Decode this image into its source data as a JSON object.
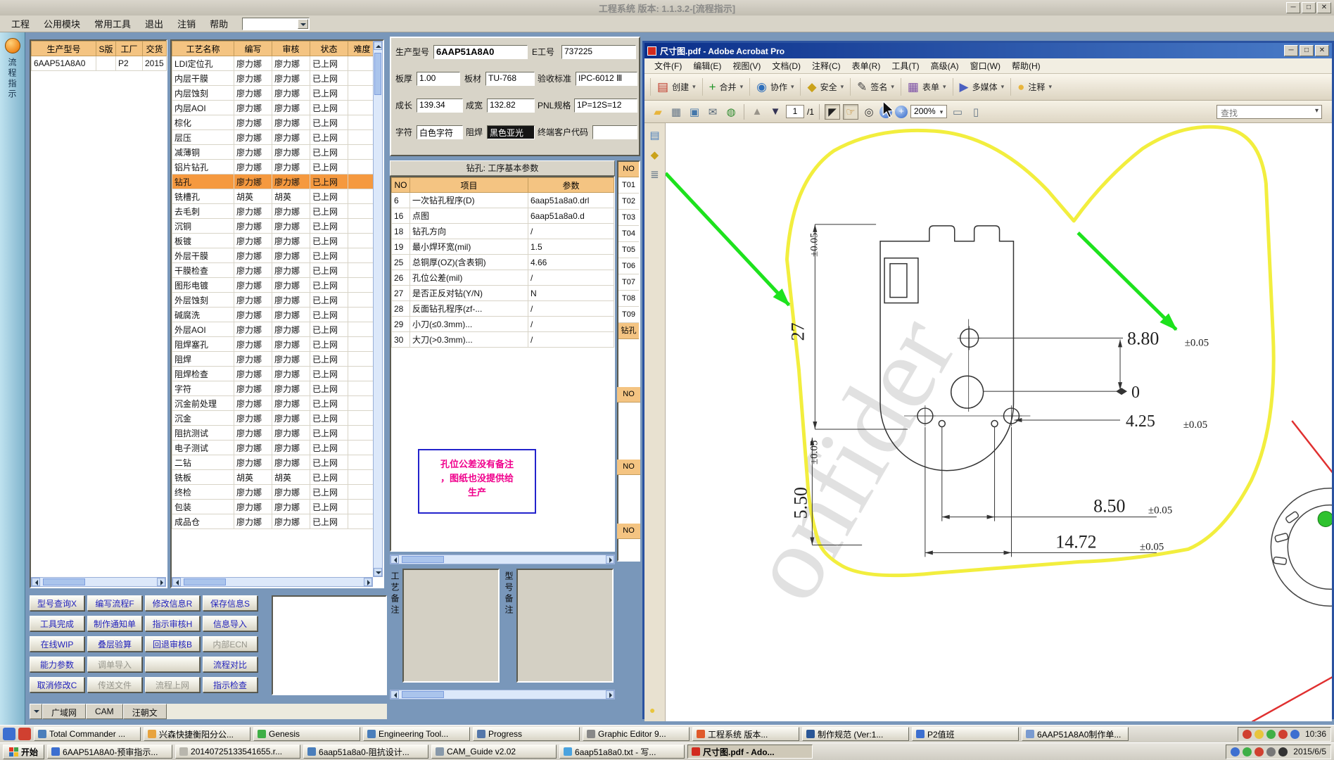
{
  "win_glyphs": {
    "min": "─",
    "max": "□",
    "close": "✕"
  },
  "eng": {
    "title": "工程系统 版本: 1.1.3.2-[流程指示]",
    "menu": [
      "工程",
      "公用模块",
      "常用工具",
      "退出",
      "注销",
      "帮助"
    ],
    "strip_label": "流程指示",
    "product": {
      "headers": [
        "生产型号",
        "S版",
        "工厂",
        "交货"
      ],
      "rows": [
        {
          "model": "6AAP51A8A0",
          "sver": "",
          "factory": "P2",
          "delivery": "2015"
        }
      ]
    },
    "process": {
      "headers": [
        "工艺名称",
        "编写",
        "审核",
        "状态",
        "难度"
      ],
      "rows": [
        {
          "name": "LDI定位孔",
          "writer": "廖力娜",
          "auditor": "廖力娜",
          "status": "已上网",
          "diff": ""
        },
        {
          "name": "内层干膜",
          "writer": "廖力娜",
          "auditor": "廖力娜",
          "status": "已上网",
          "diff": ""
        },
        {
          "name": "内层蚀刻",
          "writer": "廖力娜",
          "auditor": "廖力娜",
          "status": "已上网",
          "diff": ""
        },
        {
          "name": "内层AOI",
          "writer": "廖力娜",
          "auditor": "廖力娜",
          "status": "已上网",
          "diff": ""
        },
        {
          "name": "棕化",
          "writer": "廖力娜",
          "auditor": "廖力娜",
          "status": "已上网",
          "diff": ""
        },
        {
          "name": "层压",
          "writer": "廖力娜",
          "auditor": "廖力娜",
          "status": "已上网",
          "diff": ""
        },
        {
          "name": "减薄铜",
          "writer": "廖力娜",
          "auditor": "廖力娜",
          "status": "已上网",
          "diff": ""
        },
        {
          "name": "铝片钻孔",
          "writer": "廖力娜",
          "auditor": "廖力娜",
          "status": "已上网",
          "diff": ""
        },
        {
          "name": "钻孔",
          "writer": "廖力娜",
          "auditor": "廖力娜",
          "status": "已上网",
          "diff": "",
          "hl": true
        },
        {
          "name": "铣槽孔",
          "writer": "胡英",
          "auditor": "胡英",
          "status": "已上网",
          "diff": ""
        },
        {
          "name": "去毛刺",
          "writer": "廖力娜",
          "auditor": "廖力娜",
          "status": "已上网",
          "diff": ""
        },
        {
          "name": "沉铜",
          "writer": "廖力娜",
          "auditor": "廖力娜",
          "status": "已上网",
          "diff": ""
        },
        {
          "name": "板镀",
          "writer": "廖力娜",
          "auditor": "廖力娜",
          "status": "已上网",
          "diff": ""
        },
        {
          "name": "外层干膜",
          "writer": "廖力娜",
          "auditor": "廖力娜",
          "status": "已上网",
          "diff": ""
        },
        {
          "name": "干膜检查",
          "writer": "廖力娜",
          "auditor": "廖力娜",
          "status": "已上网",
          "diff": ""
        },
        {
          "name": "图形电镀",
          "writer": "廖力娜",
          "auditor": "廖力娜",
          "status": "已上网",
          "diff": ""
        },
        {
          "name": "外层蚀刻",
          "writer": "廖力娜",
          "auditor": "廖力娜",
          "status": "已上网",
          "diff": ""
        },
        {
          "name": "碱腐洗",
          "writer": "廖力娜",
          "auditor": "廖力娜",
          "status": "已上网",
          "diff": ""
        },
        {
          "name": "外层AOI",
          "writer": "廖力娜",
          "auditor": "廖力娜",
          "status": "已上网",
          "diff": ""
        },
        {
          "name": "阻焊塞孔",
          "writer": "廖力娜",
          "auditor": "廖力娜",
          "status": "已上网",
          "diff": ""
        },
        {
          "name": "阻焊",
          "writer": "廖力娜",
          "auditor": "廖力娜",
          "status": "已上网",
          "diff": ""
        },
        {
          "name": "阻焊检查",
          "writer": "廖力娜",
          "auditor": "廖力娜",
          "status": "已上网",
          "diff": ""
        },
        {
          "name": "字符",
          "writer": "廖力娜",
          "auditor": "廖力娜",
          "status": "已上网",
          "diff": ""
        },
        {
          "name": "沉金前处理",
          "writer": "廖力娜",
          "auditor": "廖力娜",
          "status": "已上网",
          "diff": ""
        },
        {
          "name": "沉金",
          "writer": "廖力娜",
          "auditor": "廖力娜",
          "status": "已上网",
          "diff": ""
        },
        {
          "name": "阻抗测试",
          "writer": "廖力娜",
          "auditor": "廖力娜",
          "status": "已上网",
          "diff": ""
        },
        {
          "name": "电子测试",
          "writer": "廖力娜",
          "auditor": "廖力娜",
          "status": "已上网",
          "diff": ""
        },
        {
          "name": "二钻",
          "writer": "廖力娜",
          "auditor": "廖力娜",
          "status": "已上网",
          "diff": ""
        },
        {
          "name": "铣板",
          "writer": "胡英",
          "auditor": "胡英",
          "status": "已上网",
          "diff": ""
        },
        {
          "name": "终检",
          "writer": "廖力娜",
          "auditor": "廖力娜",
          "status": "已上网",
          "diff": ""
        },
        {
          "name": "包装",
          "writer": "廖力娜",
          "auditor": "廖力娜",
          "status": "已上网",
          "diff": ""
        },
        {
          "name": "成品仓",
          "writer": "廖力娜",
          "auditor": "廖力娜",
          "status": "已上网",
          "diff": ""
        }
      ]
    },
    "info": {
      "model_label": "生产型号",
      "model": "6AAP51A8A0",
      "eid_label": "E工号",
      "eid": "737225",
      "thick_label": "板厚",
      "thick": "1.00",
      "mat_label": "板材",
      "mat": "TU-768",
      "std_label": "验收标准",
      "std": "IPC-6012 Ⅲ",
      "len_label": "成长",
      "len": "139.34",
      "wid_label": "成宽",
      "wid": "132.82",
      "pnl_label": "PNL规格",
      "pnl": "1P=12S=12",
      "char_label": "字符",
      "char": "白色字符",
      "mask_label": "阻焊",
      "mask": "黑色亚光",
      "cli_label": "终端客户代码",
      "cli": ""
    },
    "params": {
      "title": "钻孔: 工序基本参数",
      "headers": [
        "NO",
        "项目",
        "参数"
      ],
      "rows": [
        {
          "no": "6",
          "item": "一次钻孔程序(D)",
          "val": "6aap51a8a0.drl"
        },
        {
          "no": "16",
          "item": "点图",
          "val": "6aap51a8a0.d"
        },
        {
          "no": "18",
          "item": "钻孔方向",
          "val": "/"
        },
        {
          "no": "19",
          "item": "最小焊环宽(mil)",
          "val": "1.5"
        },
        {
          "no": "25",
          "item": "总铜厚(OZ)(含表铜)",
          "val": "4.66"
        },
        {
          "no": "26",
          "item": "孔位公差(mil)",
          "val": "/"
        },
        {
          "no": "27",
          "item": "是否正反对钻(Y/N)",
          "val": "N"
        },
        {
          "no": "28",
          "item": "反面钻孔程序(zf-...",
          "val": "/"
        },
        {
          "no": "29",
          "item": "小刀(≤0.3mm)...",
          "val": "/"
        },
        {
          "no": "30",
          "item": "大刀(>0.3mm)...",
          "val": "/"
        }
      ]
    },
    "toolcol": {
      "header": "NO",
      "items": [
        {
          "t": "T01"
        },
        {
          "t": "T02"
        },
        {
          "t": "T03"
        },
        {
          "t": "T04"
        },
        {
          "t": "T05"
        },
        {
          "t": "T06"
        },
        {
          "t": "T07"
        },
        {
          "t": "T08"
        },
        {
          "t": "T09"
        },
        {
          "t": "钻孔",
          "head": true
        }
      ],
      "sub": [
        "NO",
        "NO",
        "NO"
      ]
    },
    "warning": [
      "孔位公差没有备注",
      "，图纸也没提供给",
      "生产"
    ],
    "remarks": {
      "left": "工艺备注",
      "right": "型号备注"
    },
    "buttons": [
      {
        "label": "型号查询X"
      },
      {
        "label": "编写流程F"
      },
      {
        "label": "修改信息R"
      },
      {
        "label": "保存信息S"
      },
      {
        "label": "工具完成"
      },
      {
        "label": "制作通知单"
      },
      {
        "label": "指示审核H"
      },
      {
        "label": "信息导入"
      },
      {
        "label": "在线WIP"
      },
      {
        "label": "叠层验算"
      },
      {
        "label": "回退审核B"
      },
      {
        "label": "内部ECN",
        "enabled": false
      },
      {
        "label": "能力参数"
      },
      {
        "label": "调单导入",
        "enabled": false
      },
      {
        "label": "",
        "enabled": false
      },
      {
        "label": "流程对比"
      },
      {
        "label": "取消修改C"
      },
      {
        "label": "传送文件",
        "enabled": false
      },
      {
        "label": "流程上网",
        "enabled": false
      },
      {
        "label": "指示检查"
      }
    ],
    "tabs": [
      "广域网",
      "CAM",
      "汪朝文"
    ]
  },
  "acrobat": {
    "title": "尺寸图.pdf - Adobe Acrobat Pro",
    "menu": [
      "文件(F)",
      "编辑(E)",
      "视图(V)",
      "文档(D)",
      "注释(C)",
      "表单(R)",
      "工具(T)",
      "高级(A)",
      "窗口(W)",
      "帮助(H)"
    ],
    "toolbar1": [
      {
        "label": "创建",
        "glyph": "▤",
        "color": "#c03a2b"
      },
      {
        "label": "合并",
        "glyph": "+",
        "color": "#1f9427"
      },
      {
        "label": "协作",
        "glyph": "◉",
        "color": "#2e6fbb"
      },
      {
        "label": "安全",
        "glyph": "◆",
        "color": "#caa21a"
      },
      {
        "label": "签名",
        "glyph": "✎",
        "color": "#444444"
      },
      {
        "label": "表单",
        "glyph": "▦",
        "color": "#7b4fa6"
      },
      {
        "label": "多媒体",
        "glyph": "▶",
        "color": "#4a5fc0"
      },
      {
        "label": "注释",
        "glyph": "●",
        "color": "#e8b53d"
      }
    ],
    "nav": {
      "page": "1",
      "total": "/1",
      "zoom": "200%",
      "find": "查找"
    },
    "drawing": {
      "watermark": "onfider",
      "dim_27": "27",
      "tol_27": "±0.05",
      "dim_550": "5.50",
      "tol_550": "±0.05",
      "dim_880": "8.80",
      "tol_880": "±0.05",
      "dim_0": "0",
      "dim_425": "4.25",
      "tol_425": "±0.05",
      "dim_850": "8.50",
      "tol_850": "±0.05",
      "dim_1472": "14.72",
      "tol_1472": "±0.05"
    }
  },
  "taskbar": {
    "start": "开始",
    "clock": "10:36",
    "date": "2015/6/5",
    "row1": [
      {
        "label": "Total Commander ...",
        "color": "#4a7ebb"
      },
      {
        "label": "兴森快捷衡阳分公...",
        "color": "#e8a33d"
      },
      {
        "label": "Genesis",
        "color": "#3faf46"
      },
      {
        "label": "Engineering Tool...",
        "color": "#4a7ebb"
      },
      {
        "label": "Progress",
        "color": "#5577aa"
      },
      {
        "label": "Graphic Editor 9...",
        "color": "#888888"
      },
      {
        "label": "工程系统  版本...",
        "color": "#e05a2b"
      },
      {
        "label": "制作规范 (Ver:1...",
        "color": "#2b5797"
      },
      {
        "label": "P2值班",
        "color": "#3d6fd0"
      },
      {
        "label": "6AAP51A8A0制作单...",
        "color": "#7a9bd0"
      }
    ],
    "row2": [
      {
        "label": "6AAP51A8A0-预审指示...",
        "color": "#3d6fd0"
      },
      {
        "label": "20140725133541655.r...",
        "color": "#b8b6ad"
      },
      {
        "label": "6aap51a8a0-阻抗设计...",
        "color": "#4a7ebb"
      },
      {
        "label": "CAM_Guide v2.02",
        "color": "#8899aa"
      },
      {
        "label": "6aap51a8a0.txt - 写...",
        "color": "#4aa3df"
      },
      {
        "label": "尺寸图.pdf - Ado...",
        "color": "#d22b1f",
        "active": true
      }
    ],
    "tray1": [
      {
        "color": "#d04030"
      },
      {
        "color": "#e8c53d"
      },
      {
        "color": "#3faf46"
      },
      {
        "color": "#d04030"
      },
      {
        "color": "#3d6fd0"
      }
    ],
    "tray2": [
      {
        "color": "#3d6fd0"
      },
      {
        "color": "#3faf46"
      },
      {
        "color": "#d04030"
      },
      {
        "color": "#777777"
      },
      {
        "color": "#333333"
      }
    ]
  }
}
